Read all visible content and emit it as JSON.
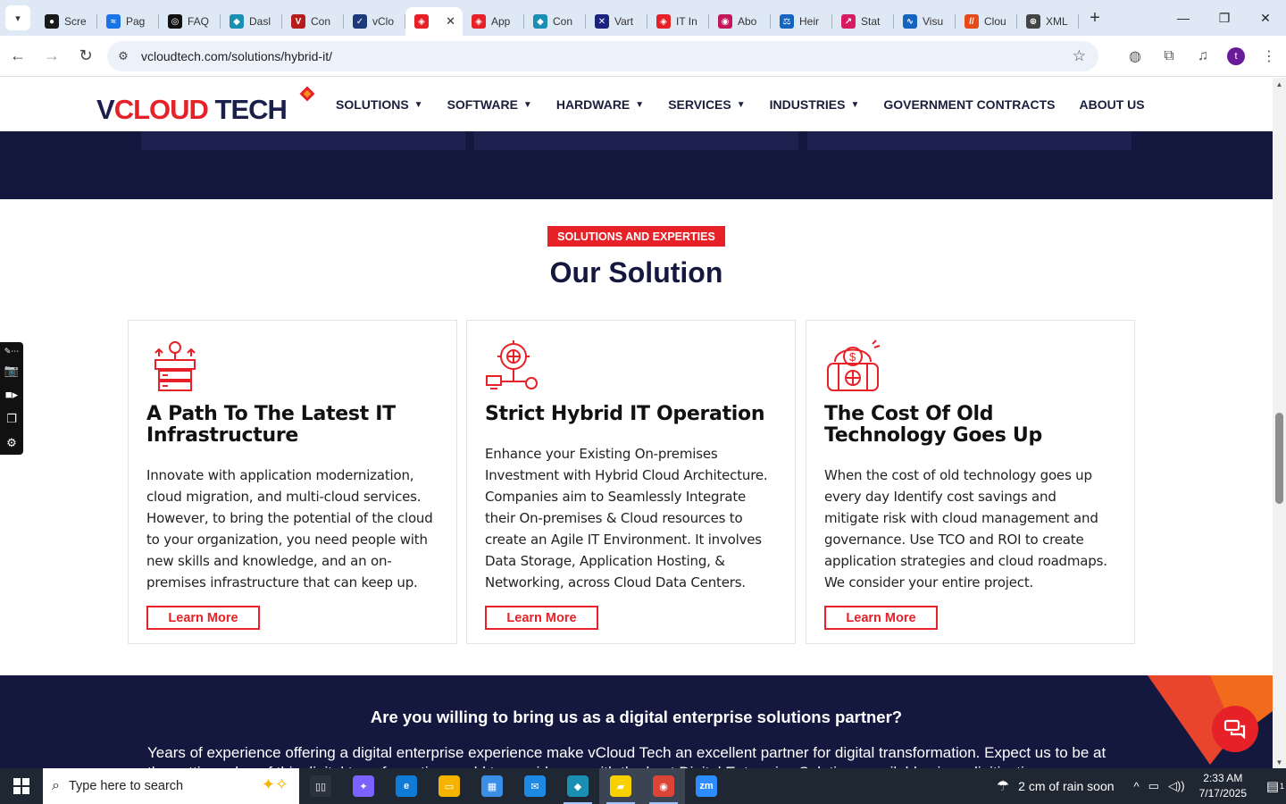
{
  "browser": {
    "tabs": [
      {
        "label": "Scre",
        "color": "#1a1a1a",
        "glyph": "●"
      },
      {
        "label": "Pag",
        "color": "#1a73e8",
        "glyph": "≈"
      },
      {
        "label": "FAQ",
        "color": "#111111",
        "glyph": "◎"
      },
      {
        "label": "Dasl",
        "color": "#1b8fb3",
        "glyph": "◆"
      },
      {
        "label": "Con",
        "color": "#b71c1c",
        "glyph": "V"
      },
      {
        "label": "vClo",
        "color": "#1b3a7a",
        "glyph": "✓"
      },
      {
        "label": "",
        "color": "#e62228",
        "glyph": "◈",
        "active": true
      },
      {
        "label": "App",
        "color": "#e62228",
        "glyph": "◈"
      },
      {
        "label": "Con",
        "color": "#1b8fb3",
        "glyph": "◆"
      },
      {
        "label": "Vart",
        "color": "#1a237e",
        "glyph": "✕"
      },
      {
        "label": "IT In",
        "color": "#e62228",
        "glyph": "◈"
      },
      {
        "label": "Abo",
        "color": "#c2185b",
        "glyph": "◉"
      },
      {
        "label": "Heir",
        "color": "#1565c0",
        "glyph": "⚖"
      },
      {
        "label": "Stat",
        "color": "#d81b60",
        "glyph": "↗"
      },
      {
        "label": "Visu",
        "color": "#1565c0",
        "glyph": "∿"
      },
      {
        "label": "Clou",
        "color": "#e64a19",
        "glyph": "//"
      },
      {
        "label": "XML",
        "color": "#444444",
        "glyph": "⊕"
      }
    ],
    "url": "vcloudtech.com/solutions/hybrid-it/",
    "profile_initial": "t"
  },
  "site": {
    "logo": {
      "v": "V",
      "cloud": "CLOUD",
      "tech": " TECH"
    },
    "nav": [
      {
        "label": "SOLUTIONS",
        "dropdown": true
      },
      {
        "label": "SOFTWARE",
        "dropdown": true
      },
      {
        "label": "HARDWARE",
        "dropdown": true
      },
      {
        "label": "SERVICES",
        "dropdown": true
      },
      {
        "label": "INDUSTRIES",
        "dropdown": true
      },
      {
        "label": "GOVERNMENT CONTRACTS",
        "dropdown": false
      },
      {
        "label": "ABOUT US",
        "dropdown": false
      }
    ],
    "section_tag": "SOLUTIONS AND EXPERTIES",
    "section_title": "Our Solution",
    "cards": [
      {
        "icon": "server-upgrade-icon",
        "title": "A Path To The Latest IT Infrastructure",
        "text": "Innovate with application modernization, cloud migration, and multi-cloud services. However, to bring the potential of the cloud to your organization, you need people with new skills and knowledge, and an on-premises infrastructure that can keep up.",
        "button": "Learn More"
      },
      {
        "icon": "hybrid-network-gear-icon",
        "title": "Strict Hybrid IT Operation",
        "text": "Enhance your Existing On-premises Investment with Hybrid Cloud Architecture. Companies aim to Seamlessly Integrate their On-premises & Cloud resources to create an Agile IT Environment. It involves Data Storage, Application Hosting, & Networking, across Cloud Data Centers.",
        "button": "Learn More"
      },
      {
        "icon": "cost-piggy-bank-icon",
        "title": "The Cost Of Old Technology Goes Up",
        "text": "When the cost of old technology goes up every day Identify cost savings and mitigate risk with cloud management and governance. Use TCO and ROI to create application strategies and cloud roadmaps. We consider your entire project.",
        "button": "Learn More"
      }
    ],
    "cta_question": "Are you willing to bring us as a digital enterprise solutions partner?",
    "cta_description": "Years of experience offering a digital enterprise experience make vCloud Tech an excellent partner for digital transformation. Expect us to be at the cutting edge of this digital transformation world to provide you with the best Digital Enterprise Solutions available since digitization"
  },
  "taskbar": {
    "search_placeholder": "Type here to search",
    "weather": "2 cm of rain soon",
    "time": "2:33 AM",
    "date": "7/17/2025",
    "notification_count": "1",
    "apps": [
      {
        "name": "task-view",
        "color": "#2b3340",
        "glyph": "▯▯"
      },
      {
        "name": "copilot",
        "color": "#7b61ff",
        "glyph": "✦"
      },
      {
        "name": "edge",
        "color": "#0f7bd6",
        "glyph": "e"
      },
      {
        "name": "file-explorer",
        "color": "#f4b400",
        "glyph": "▭"
      },
      {
        "name": "store",
        "color": "#3a8ee6",
        "glyph": "▦"
      },
      {
        "name": "mail",
        "color": "#1e88e5",
        "glyph": "✉"
      },
      {
        "name": "app-diamond",
        "color": "#1b8fb3",
        "glyph": "◆"
      },
      {
        "name": "sticky-notes",
        "color": "#f7d200",
        "glyph": "▰"
      },
      {
        "name": "chrome",
        "color": "#db4437",
        "glyph": "◉"
      },
      {
        "name": "zoom",
        "color": "#2d8cff",
        "glyph": "zm"
      }
    ]
  }
}
